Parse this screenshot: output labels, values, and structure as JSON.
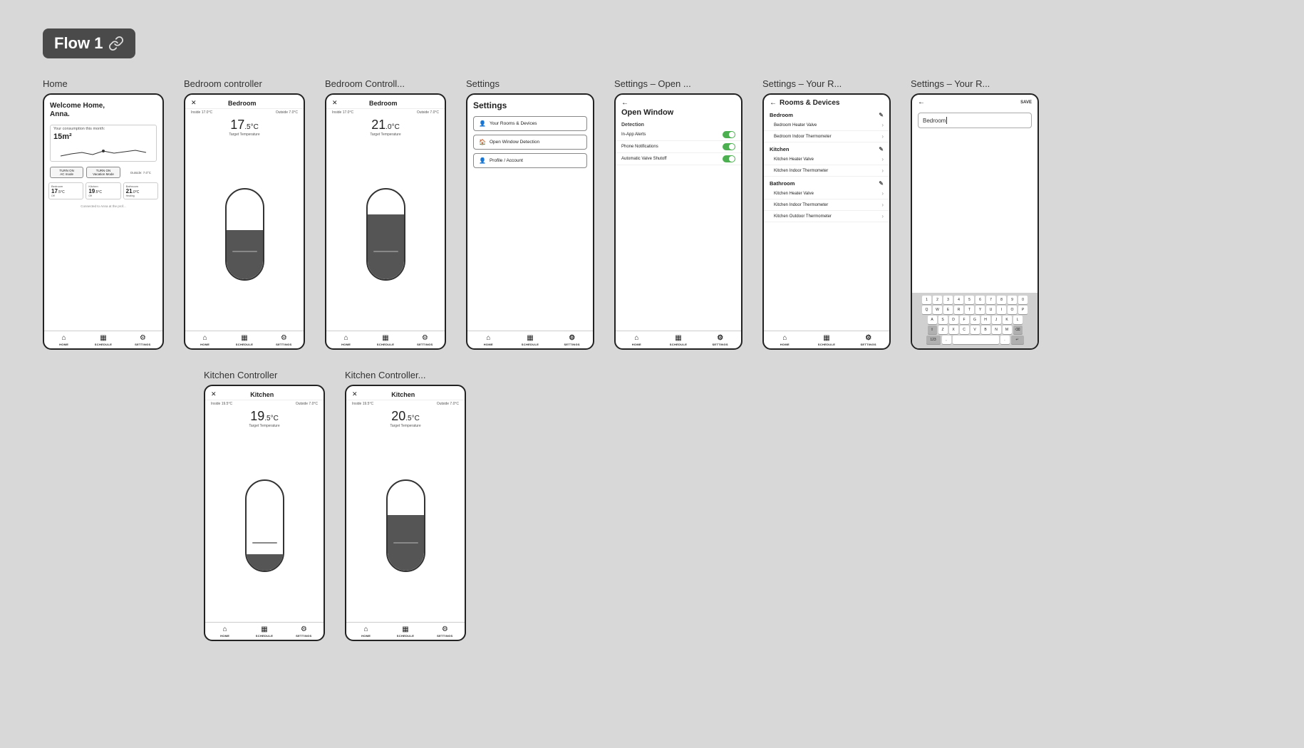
{
  "flow": {
    "title": "Flow 1",
    "link_icon": "🔗"
  },
  "screens": [
    {
      "id": "home",
      "label": "Home",
      "type": "home"
    },
    {
      "id": "bedroom-controller",
      "label": "Bedroom controller",
      "type": "controller",
      "room": "Bedroom",
      "inside_temp": "Inside 17.0°C",
      "outside_temp": "Outside 7.0°C",
      "target_temp": "17",
      "target_sub": "5°C",
      "fill_pct": 55
    },
    {
      "id": "bedroom-controller2",
      "label": "Bedroom Controll...",
      "type": "controller",
      "room": "Bedroom",
      "inside_temp": "Inside 17.0°C",
      "outside_temp": "Outside 7.0°C",
      "target_temp": "21",
      "target_sub": ".0°C",
      "fill_pct": 75
    },
    {
      "id": "settings",
      "label": "Settings",
      "type": "settings-menu"
    },
    {
      "id": "open-window",
      "label": "Settings – Open ...",
      "type": "open-window"
    },
    {
      "id": "rooms-devices",
      "label": "Settings – Your R...",
      "type": "rooms-devices"
    },
    {
      "id": "rooms-devices2",
      "label": "Settings – Your R...",
      "type": "keyboard"
    },
    {
      "id": "kitchen-controller",
      "label": "Kitchen Controller",
      "type": "controller",
      "room": "Kitchen",
      "inside_temp": "Inside 19.5°C",
      "outside_temp": "Outside 7.0°C",
      "target_temp": "19",
      "target_sub": "5°C",
      "fill_pct": 20
    },
    {
      "id": "kitchen-controller2",
      "label": "Kitchen Controller...",
      "type": "controller",
      "room": "Kitchen",
      "inside_temp": "Inside 19.5°C",
      "outside_temp": "Outside 7.0°C",
      "target_temp": "20",
      "target_sub": ".5°C",
      "fill_pct": 65
    }
  ],
  "home_screen": {
    "title": "Welcome Home,",
    "name": "Anna.",
    "chart_label": "Your consumption this month:",
    "chart_value": "15m²",
    "buttons": [
      "TURN ON\nAC mode",
      "TURN ON\nVacation Mode"
    ],
    "outside": "Outside: 7.0°C",
    "rooms": [
      {
        "name": "Bedroom",
        "temp": "17",
        "sub": ".5°C",
        "status": "Off"
      },
      {
        "name": "Kitchen",
        "temp": "19",
        "sub": ".5°C",
        "status": "Off"
      },
      {
        "name": "Bathroom",
        "temp": "21",
        "sub": ".0°C",
        "status": "Heating"
      }
    ],
    "connected_text": "Connected to Anna at the prof..."
  },
  "settings_menu": {
    "title": "Settings",
    "items": [
      {
        "icon": "👤",
        "label": "Your Rooms & Devices"
      },
      {
        "icon": "🏠",
        "label": "Open Window Detection"
      },
      {
        "icon": "👤",
        "label": "Profile / Account"
      }
    ]
  },
  "open_window": {
    "title": "Open Window",
    "section": "Detection",
    "rows": [
      {
        "label": "In-App Alerts",
        "on": true
      },
      {
        "label": "Phone Notifications",
        "on": true
      },
      {
        "label": "Automatic Valve Shutoff",
        "on": true
      }
    ]
  },
  "rooms_devices": {
    "title": "Rooms & Devices",
    "sections": [
      {
        "name": "Bedroom",
        "items": [
          "Bedroom Heater Valve",
          "Bedroom Indoor Thermometer"
        ]
      },
      {
        "name": "Kitchen",
        "items": [
          "Kitchen Heater Valve",
          "Kitchen Indoor Thermometer"
        ]
      },
      {
        "name": "Bathroom",
        "items": [
          "Kitchen Heater Valve",
          "Kitchen Indoor Thermometer",
          "Kitchen Outdoor Thermometer"
        ]
      }
    ]
  },
  "keyboard_screen": {
    "input_value": "Bedroom",
    "save_label": "SAVE",
    "rows": [
      [
        "1",
        "2",
        "3",
        "4",
        "5",
        "6",
        "7",
        "8",
        "9",
        "0"
      ],
      [
        "Q",
        "W",
        "E",
        "R",
        "T",
        "Y",
        "U",
        "I",
        "O",
        "P"
      ],
      [
        "A",
        "S",
        "D",
        "F",
        "G",
        "H",
        "J",
        "K",
        "L"
      ],
      [
        "⇧",
        "Z",
        "X",
        "C",
        "V",
        "B",
        "N",
        "M",
        "⌫"
      ],
      [
        "123",
        ",",
        "space",
        ".",
        "↵"
      ]
    ]
  },
  "nav": {
    "items": [
      {
        "icon": "⌂",
        "label": "HOME"
      },
      {
        "icon": "▦",
        "label": "SCHEDULE"
      },
      {
        "icon": "⚙",
        "label": "SETTINGS"
      }
    ]
  }
}
